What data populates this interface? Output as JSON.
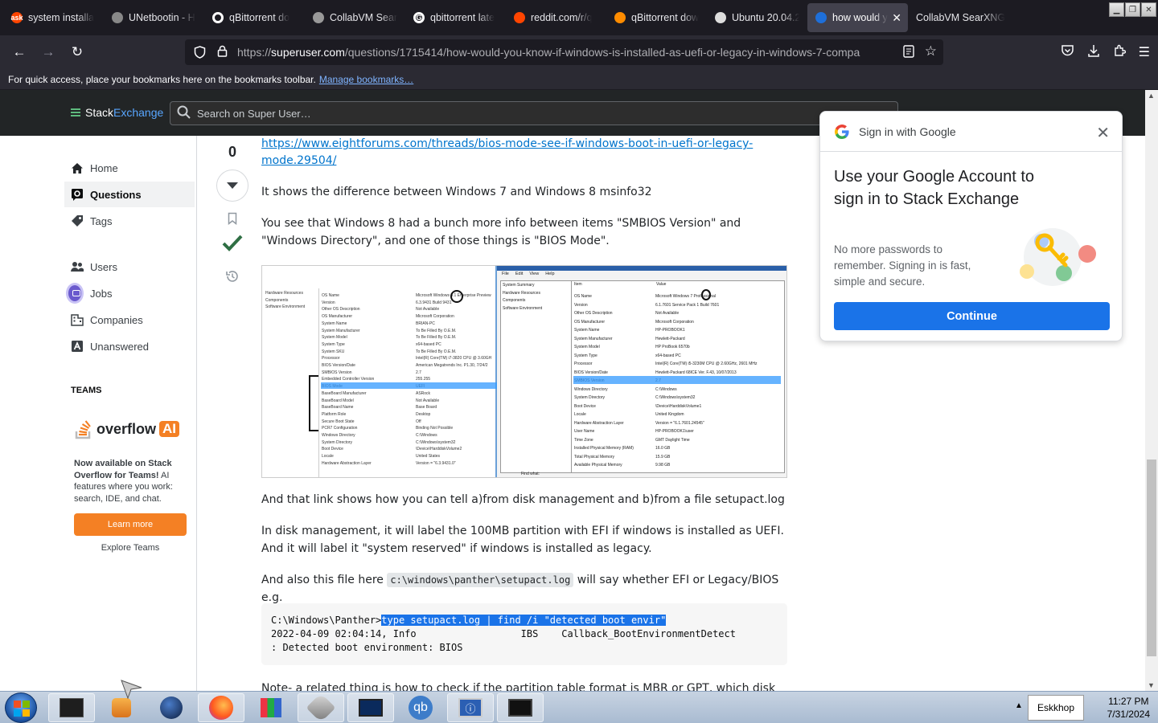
{
  "browser": {
    "tabs": [
      {
        "title": "system installa",
        "fav_color": "#ff4500",
        "fav_text": "ask"
      },
      {
        "title": "UNetbootin - H",
        "fav_color": "#888888",
        "fav_text": ""
      },
      {
        "title": "qBittorrent do",
        "fav_color": "#ffffff",
        "fav_text": ""
      },
      {
        "title": "CollabVM Sear",
        "fav_color": "#999999",
        "fav_text": ""
      },
      {
        "title": "qbittorrent late",
        "fav_color": "#ffffff",
        "fav_text": "G"
      },
      {
        "title": "reddit.com/r/q",
        "fav_color": "#ff4500",
        "fav_text": ""
      },
      {
        "title": "qBittorrent dow",
        "fav_color": "#ff8c00",
        "fav_text": ""
      },
      {
        "title": "Ubuntu 20.04.2",
        "fav_color": "#dddddd",
        "fav_text": ""
      },
      {
        "title": "how would y",
        "fav_color": "#1e6fd9",
        "fav_text": "",
        "active": true
      },
      {
        "title": "CollabVM SearXNG",
        "fav_color": "",
        "fav_text": ""
      }
    ],
    "url_prefix": "https://",
    "url_domain": "superuser.com",
    "url_path": "/questions/1715414/how-would-you-know-if-windows-is-installed-as-uefi-or-legacy-in-windows-7-compa",
    "bookmarks_text": "For quick access, place your bookmarks here on the bookmarks toolbar.",
    "bookmarks_link": "Manage bookmarks…"
  },
  "site": {
    "logo_stack": "Stack",
    "logo_exchange": "Exchange",
    "search_placeholder": "Search on Super User…"
  },
  "sidebar": {
    "items": [
      {
        "label": "Home",
        "icon": "home-icon"
      },
      {
        "label": "Questions",
        "icon": "questions-icon"
      },
      {
        "label": "Tags",
        "icon": "tag-icon"
      },
      {
        "label": "Users",
        "icon": "users-icon"
      },
      {
        "label": "Jobs",
        "icon": "briefcase-icon"
      },
      {
        "label": "Companies",
        "icon": "building-icon"
      },
      {
        "label": "Unanswered",
        "icon": "unanswered-icon"
      }
    ],
    "teams_heading": "TEAMS",
    "overflow_text": "overflow",
    "overflow_ai": "AI",
    "teams_bold": "Now available on Stack Overflow for Teams!",
    "teams_rest": " AI features where you work: search, IDE, and chat.",
    "learn_more": "Learn more",
    "explore_teams": "Explore Teams"
  },
  "post": {
    "vote_count": "0",
    "link_text": "https://www.eightforums.com/threads/bios-mode-see-if-windows-boot-in-uefi-or-legacy-mode.29504/",
    "p1": "It shows the difference between Windows 7 and Windows 8 msinfo32",
    "p2": "You see that Windows 8 had a bunch more info between items \"SMBIOS Version\" and \"Windows Directory\", and one of those things is \"BIOS Mode\".",
    "p3": "And that link shows how you can tell a)from disk management and b)from a file setupact.log",
    "p4": "In disk management, it will label the 100MB partition with EFI if windows is installed as UEFI. And it will label it \"system reserved\" if windows is installed as legacy.",
    "p5_pre": "And also this file here ",
    "p5_code": "c:\\windows\\panther\\setupact.log",
    "p5_post": " will say whether EFI or Legacy/BIOS e.g.",
    "code_prompt": "C:\\Windows\\Panther>",
    "code_selected": "type setupact.log | find /i \"detected boot envir\"",
    "code_line2": "2022-04-09 02:04:14, Info                  IBS    Callback_BootEnvironmentDetect",
    "code_line3": ": Detected boot environment: BIOS",
    "p6": "Note- a related thing is how to check if the partition table format is MBR or GPT, which disk"
  },
  "screenshot_left": {
    "tree": [
      "Hardware Resources",
      "Components",
      "Software Environment"
    ],
    "items": [
      "OS Name",
      "Version",
      "Other OS Description",
      "OS Manufacturer",
      "System Name",
      "System Manufacturer",
      "System Model",
      "System Type",
      "System SKU",
      "Processor",
      "BIOS Version/Date",
      "SMBIOS Version",
      "Embedded Controller Version",
      "BIOS Mode",
      "BaseBoard Manufacturer",
      "BaseBoard Model",
      "BaseBoard Name",
      "Platform Role",
      "Secure Boot State",
      "PCR7 Configuration",
      "Windows Directory",
      "System Directory",
      "Boot Device",
      "Locale",
      "Hardware Abstraction Layer"
    ],
    "values": [
      "Microsoft Windows 8.1 Enterprise Preview",
      "6.3.9431 Build 9431",
      "Not Available",
      "Microsoft Corporation",
      "BRIAN-PC",
      "To Be Filled By O.E.M.",
      "To Be Filled By O.E.M.",
      "x64-based PC",
      "To Be Filled By O.E.M.",
      "Intel(R) Core(TM) i7-3820 CPU @ 3.60GH",
      "American Megatrends Inc. P1.30, 7/24/2",
      "2.7",
      "255.255",
      "UEFI",
      "ASRock",
      "Not Available",
      "Base Board",
      "Desktop",
      "Off",
      "Binding Not Possible",
      "C:\\Windows",
      "C:\\Windows\\system32",
      "\\Device\\HarddiskVolume2",
      "United States",
      "Version = \"6.3.9431.0\""
    ]
  },
  "screenshot_right": {
    "menu": [
      "File",
      "Edit",
      "View",
      "Help"
    ],
    "tree": [
      "System Summary",
      "Hardware Resources",
      "Components",
      "Software Environment"
    ],
    "col_item": "Item",
    "col_value": "Value",
    "items": [
      "OS Name",
      "Version",
      "Other OS Description",
      "OS Manufacturer",
      "System Name",
      "System Manufacturer",
      "System Model",
      "System Type",
      "Processor",
      "BIOS Version/Date",
      "SMBIOS Version",
      "Windows Directory",
      "System Directory",
      "Boot Device",
      "Locale",
      "Hardware Abstraction Layer",
      "User Name",
      "Time Zone",
      "Installed Physical Memory (RAM)",
      "Total Physical Memory",
      "Available Physical Memory"
    ],
    "values": [
      "Microsoft Windows 7 Professional",
      "6.1.7601 Service Pack 1 Build 7601",
      "Not Available",
      "Microsoft Corporation",
      "HP-PROBOOK1",
      "Hewlett-Packard",
      "HP ProBook 6570b",
      "x64-based PC",
      "Intel(R) Core(TM) i5-3230M CPU @ 2.60GHz, 2601 MHz",
      "Hewlett-Packard 68ICE Ver. F.43, 10/07/2013",
      "2.7",
      "C:\\Windows",
      "C:\\Windows\\system32",
      "\\Device\\HarddiskVolume1",
      "United Kingdom",
      "Version = \"6.1.7601.24545\"",
      "HP-PROBOOK1\\user",
      "GMT Daylight Time",
      "16.0 GB",
      "15.9 GB",
      "9.98 GB"
    ],
    "find_label": "Find what:"
  },
  "google": {
    "header": "Sign in with Google",
    "title": "Use your Google Account to sign in to Stack Exchange",
    "body": "No more passwords to remember. Signing in is fast, simple and secure.",
    "button": "Continue"
  },
  "taskbar": {
    "time": "11:27 PM",
    "date": "7/31/2024",
    "tray_text": "Eskkhop"
  }
}
